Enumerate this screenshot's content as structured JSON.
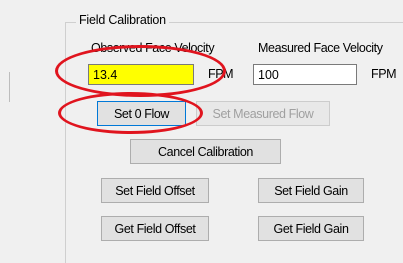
{
  "group": {
    "title": "Field Calibration"
  },
  "observed": {
    "label": "Observed Face Velocity",
    "value": "13.4",
    "unit": "FPM"
  },
  "measured": {
    "label": "Measured Face Velocity",
    "value": "100",
    "unit": "FPM"
  },
  "buttons": {
    "set_zero_flow": "Set 0 Flow",
    "set_measured_flow": "Set Measured Flow",
    "cancel_calibration": "Cancel Calibration",
    "set_field_offset": "Set Field Offset",
    "set_field_gain": "Set Field Gain",
    "get_field_offset": "Get Field Offset",
    "get_field_gain": "Get Field Gain"
  },
  "colors": {
    "highlight_field": "#ffff00",
    "annotation_circle": "#e0141e",
    "background": "#f0f0f0"
  }
}
